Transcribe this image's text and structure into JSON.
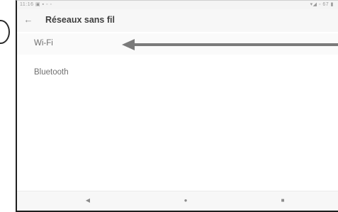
{
  "status_bar": {
    "time": "11:16",
    "left_icons": "▣ ▪ ◦ ◦",
    "right_icons": "▾◢ ◦ 67 ▮"
  },
  "app_bar": {
    "back_icon": "arrow-left",
    "title": "Réseaux sans fil"
  },
  "settings_list": [
    {
      "label": "Wi-Fi"
    },
    {
      "label": "Bluetooth"
    }
  ],
  "annotation_arrow_color": "#7a7a7a",
  "nav_bar": {
    "back_icon": "triangle-back",
    "home_icon": "circle-home",
    "recents_icon": "square-recents"
  }
}
